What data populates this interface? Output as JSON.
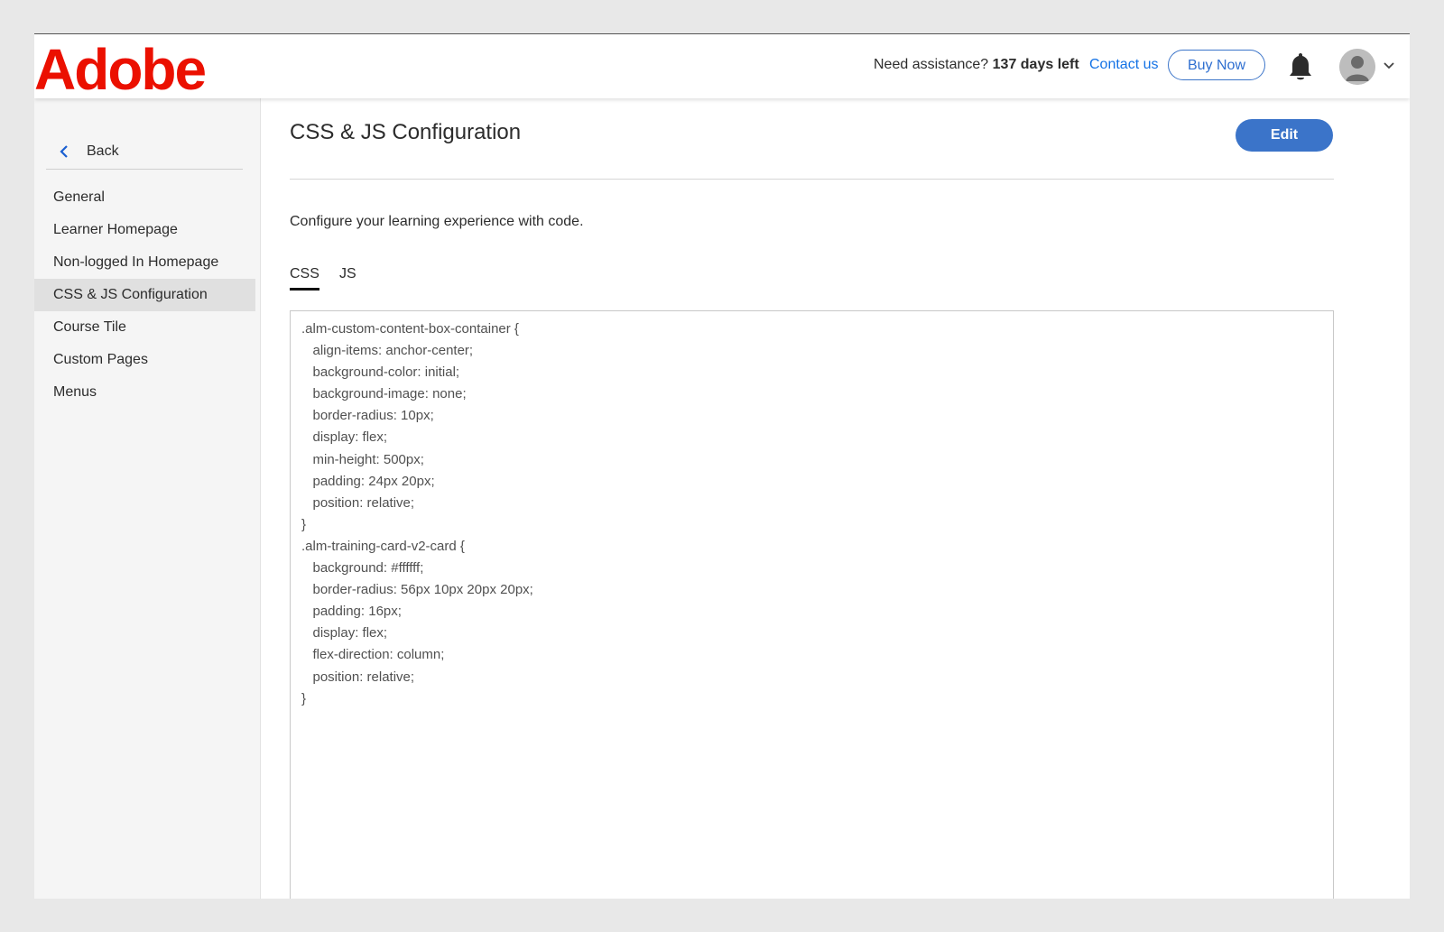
{
  "brand": {
    "name": "Adobe",
    "color": "#eb1000"
  },
  "header": {
    "assist_prefix": "Need assistance?",
    "days_left": "137 days left",
    "contact": "Contact us",
    "buy": "Buy Now",
    "notification_icon": "bell-icon",
    "avatar_icon": "user-avatar-icon"
  },
  "sidebar": {
    "back": "Back",
    "items": [
      {
        "label": "General"
      },
      {
        "label": "Learner Homepage"
      },
      {
        "label": "Non-logged In Homepage"
      },
      {
        "label": "CSS & JS Configuration"
      },
      {
        "label": "Course Tile"
      },
      {
        "label": "Custom Pages"
      },
      {
        "label": "Menus"
      }
    ],
    "active_item": "CSS & JS Configuration"
  },
  "main": {
    "title": "CSS & JS Configuration",
    "edit": "Edit",
    "description": "Configure your learning experience with code.",
    "tabs": [
      {
        "label": "CSS"
      },
      {
        "label": "JS"
      }
    ],
    "active_tab": "CSS",
    "code": ".alm-custom-content-box-container {\n   align-items: anchor-center;\n   background-color: initial;\n   background-image: none;\n   border-radius: 10px;\n   display: flex;\n   min-height: 500px;\n   padding: 24px 20px;\n   position: relative;\n}\n.alm-training-card-v2-card {\n   background: #ffffff;\n   border-radius: 56px 10px 20px 20px;\n   padding: 16px;\n   display: flex;\n   flex-direction: column;\n   position: relative;\n}"
  },
  "colors": {
    "accent": "#3b74c9",
    "link": "#1473e6"
  }
}
